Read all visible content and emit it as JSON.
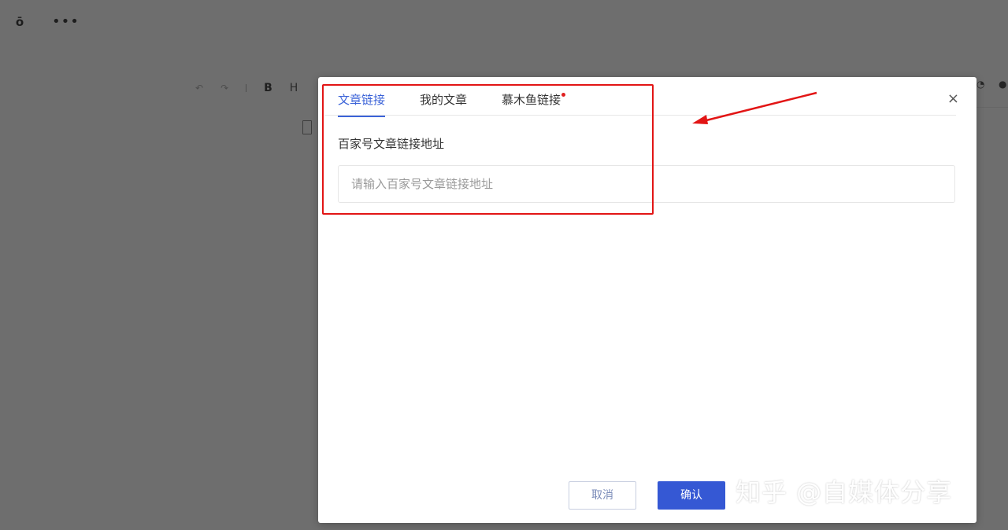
{
  "editor": {
    "toolbar": {
      "undo_icon": "undo-icon",
      "redo_icon": "redo-icon",
      "bold_label": "B",
      "heading_label": "H"
    }
  },
  "modal": {
    "tabs": [
      {
        "label": "文章链接",
        "active": true
      },
      {
        "label": "我的文章",
        "active": false
      },
      {
        "label": "慕木鱼链接",
        "active": false,
        "has_dot": true
      }
    ],
    "close_label": "×",
    "field_label": "百家号文章链接地址",
    "input_placeholder": "请输入百家号文章链接地址",
    "input_value": "",
    "cancel_label": "取消",
    "confirm_label": "确认"
  },
  "watermark": "知乎 @自媒体分享",
  "colors": {
    "accent": "#3b63d8",
    "confirm_button": "#3558d4",
    "annotation_red": "#e21515"
  }
}
